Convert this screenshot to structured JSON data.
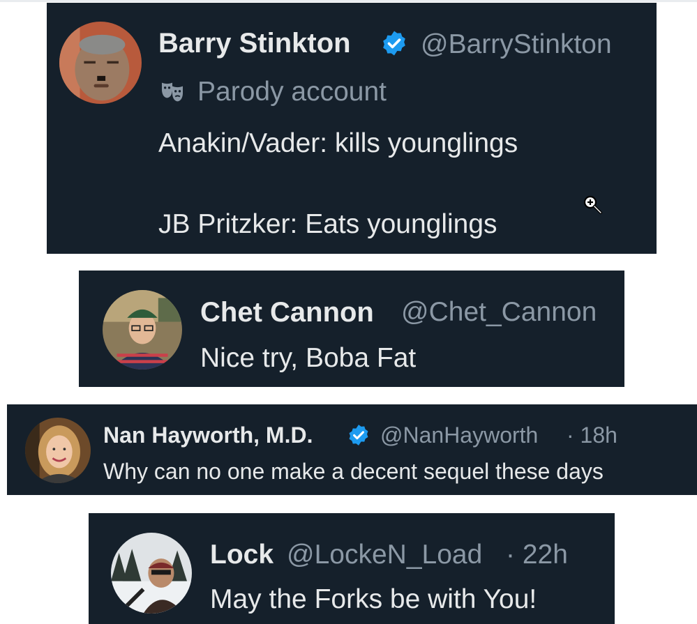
{
  "colors": {
    "card_bg": "#15202b",
    "name_text": "#e7e9ea",
    "muted_text": "#8b98a5",
    "verified_blue": "#1d9bf0"
  },
  "tweets": [
    {
      "name": "Barry Stinkton",
      "verified": true,
      "handle": "@BarryStinkton",
      "label": "Parody account",
      "label_icon": "theater-masks-icon",
      "lines": [
        "Anakin/Vader: kills younglings",
        "JB Pritzker: Eats younglings"
      ]
    },
    {
      "name": "Chet Cannon",
      "verified": false,
      "handle": "@Chet_Cannon",
      "lines": [
        "Nice try, Boba Fat"
      ]
    },
    {
      "name": "Nan Hayworth, M.D.",
      "verified": true,
      "handle": "@NanHayworth",
      "time": "· 18h",
      "lines": [
        "Why can no one make a decent sequel these days"
      ]
    },
    {
      "name": "Lock",
      "verified": false,
      "handle": "@LockeN_Load",
      "time": "· 22h",
      "lines": [
        "May the Forks be with You!"
      ]
    }
  ],
  "cursor": "zoom-in-icon"
}
